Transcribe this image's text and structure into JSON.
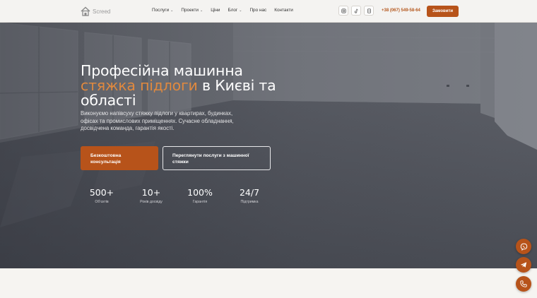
{
  "header": {
    "logo_text": "Screed",
    "nav": [
      {
        "label": "Послуги",
        "has_dropdown": true
      },
      {
        "label": "Проекти",
        "has_dropdown": true
      },
      {
        "label": "Ціни",
        "has_dropdown": false
      },
      {
        "label": "Блог",
        "has_dropdown": true
      },
      {
        "label": "Про нас",
        "has_dropdown": false
      },
      {
        "label": "Контакти",
        "has_dropdown": false
      }
    ],
    "socials": [
      "instagram-icon",
      "tiktok-icon",
      "viber-icon"
    ],
    "phone": "+38 (067) 549-58-64",
    "order_label": "Замовити"
  },
  "hero": {
    "title_part1": "Професійна машинна",
    "title_accent": "стяжка підлоги",
    "title_part2": "в Києві та області",
    "description": "Виконуємо напівсуху стяжку підлоги у квартирах, будинках, офісах та промислових приміщеннях. Сучасне обладнання, досвідчена команда, гарантія якості.",
    "primary_button": "Безкоштовна консультація",
    "secondary_button": "Переглянути послуги з машинної стяжки",
    "stats": [
      {
        "value": "500+",
        "label": "Об'єктів"
      },
      {
        "value": "10+",
        "label": "Років досвіду"
      },
      {
        "value": "100%",
        "label": "Гарантія"
      },
      {
        "value": "24/7",
        "label": "Підтримка"
      }
    ]
  },
  "floating_actions": [
    "viber-icon",
    "telegram-icon",
    "phone-icon"
  ],
  "colors": {
    "accent": "#b7531a",
    "accent_light": "#e0893f"
  }
}
